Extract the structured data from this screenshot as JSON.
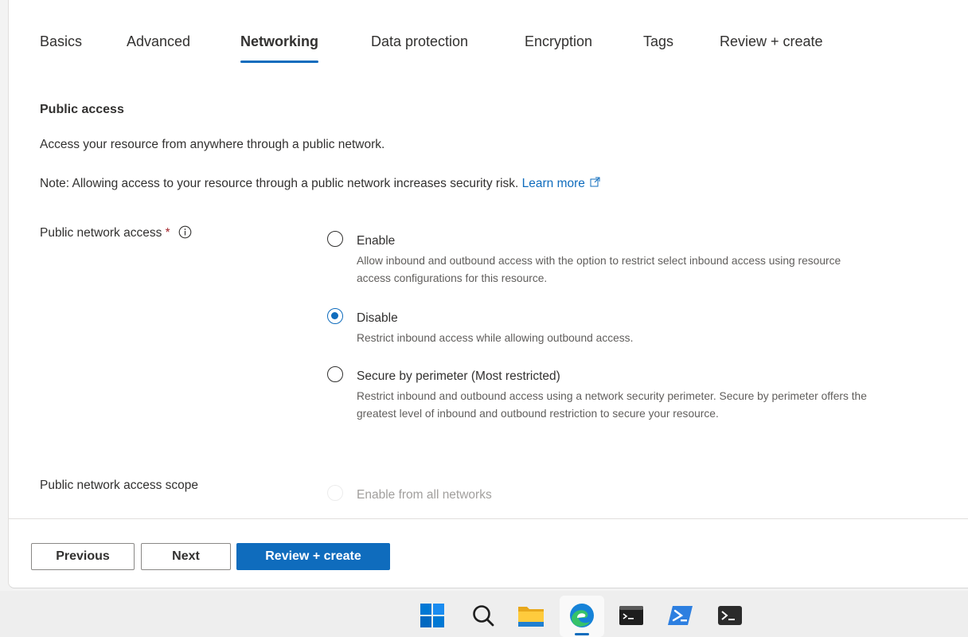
{
  "tabs": [
    {
      "label": "Basics",
      "active": false
    },
    {
      "label": "Advanced",
      "active": false
    },
    {
      "label": "Networking",
      "active": true
    },
    {
      "label": "Data protection",
      "active": false
    },
    {
      "label": "Encryption",
      "active": false
    },
    {
      "label": "Tags",
      "active": false
    },
    {
      "label": "Review + create",
      "active": false
    }
  ],
  "section": {
    "title": "Public access",
    "description": "Access your resource from anywhere through a public network.",
    "note": "Note: Allowing access to your resource through a public network increases security risk.",
    "learn_more": "Learn more"
  },
  "public_network_access": {
    "label": "Public network access",
    "required_marker": "*",
    "selected": "Disable",
    "options": [
      {
        "label": "Enable",
        "description": "Allow inbound and outbound access with the option to restrict select inbound access using resource access configurations for this resource."
      },
      {
        "label": "Disable",
        "description": "Restrict inbound access while allowing outbound access."
      },
      {
        "label": "Secure by perimeter (Most restricted)",
        "description": "Restrict inbound and outbound access using a network security perimeter. Secure by perimeter offers the greatest level of inbound and outbound restriction to secure your resource."
      }
    ]
  },
  "public_network_access_scope": {
    "label": "Public network access scope",
    "option": "Enable from all networks",
    "disabled": true
  },
  "footer": {
    "previous": "Previous",
    "next": "Next",
    "review_create": "Review + create"
  },
  "colors": {
    "accent": "#0f6cbd",
    "text": "#323130",
    "secondary_text": "#605e5c",
    "required": "#a4262c"
  },
  "taskbar": {
    "icons": [
      "windows-start-icon",
      "search-icon",
      "file-explorer-icon",
      "edge-browser-icon",
      "terminal-icon",
      "powershell-icon",
      "command-prompt-icon"
    ],
    "active": "edge-browser-icon"
  }
}
